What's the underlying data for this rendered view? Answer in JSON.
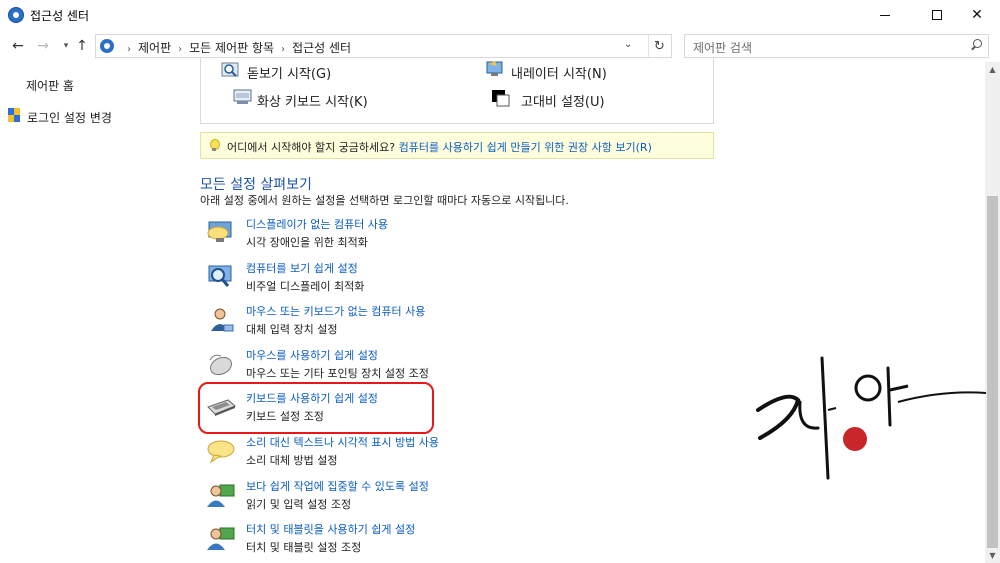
{
  "window": {
    "title": "접근성 센터"
  },
  "address_bar": {
    "breadcrumbs": [
      "제어판",
      "모든 제어판 항목",
      "접근성 센터"
    ]
  },
  "search": {
    "placeholder": "제어판 검색"
  },
  "sidebar": {
    "home_label": "제어판 홈",
    "login_label": "로그인 설정 변경"
  },
  "quick_tools": [
    {
      "label": "돋보기 시작(G)",
      "icon": "magnifier-icon"
    },
    {
      "label": "내레이터 시작(N)",
      "icon": "narrator-icon"
    },
    {
      "label": "화상 키보드 시작(K)",
      "icon": "on-screen-keyboard-icon"
    },
    {
      "label": "고대비 설정(U)",
      "icon": "high-contrast-icon"
    }
  ],
  "tip": {
    "text": "어디에서 시작해야 할지 궁금하세요?",
    "link": "컴퓨터를 사용하기 쉽게 만들기 위한 권장 사항 보기(R)"
  },
  "section": {
    "title": "모든 설정 살펴보기",
    "description": "아래 설정 중에서 원하는 설정을 선택하면 로그인할 때마다 자동으로 시작됩니다."
  },
  "items": [
    {
      "link": "디스플레이가 없는 컴퓨터 사용",
      "sub": "시각 장애인을 위한 최적화",
      "icon": "display-speech-icon"
    },
    {
      "link": "컴퓨터를 보기 쉽게 설정",
      "sub": "비주얼 디스플레이 최적화",
      "icon": "monitor-magnifier-icon"
    },
    {
      "link": "마우스 또는 키보드가 없는 컴퓨터 사용",
      "sub": "대체 입력 장치 설정",
      "icon": "user-icon"
    },
    {
      "link": "마우스를 사용하기 쉽게 설정",
      "sub": "마우스 또는 기타 포인팅 장치 설정 조정",
      "icon": "mouse-icon"
    },
    {
      "link": "키보드를 사용하기 쉽게 설정",
      "sub": "키보드 설정 조정",
      "icon": "keyboard-icon"
    },
    {
      "link": "소리 대신 텍스트나 시각적 표시 방법 사용",
      "sub": "소리 대체 방법 설정",
      "icon": "speech-bubble-icon"
    },
    {
      "link": "보다 쉽게 작업에 집중할 수 있도록 설정",
      "sub": "읽기 및 입력 설정 조정",
      "icon": "users-focus-icon"
    },
    {
      "link": "터치 및 태블릿을 사용하기 쉽게 설정",
      "sub": "터치 및 태블릿 설정 조정",
      "icon": "users-touch-icon"
    }
  ],
  "colors": {
    "link": "#0a5cc4",
    "section_title": "#1d52a8",
    "highlight": "#e81818",
    "tip_background": "#fffedc"
  }
}
